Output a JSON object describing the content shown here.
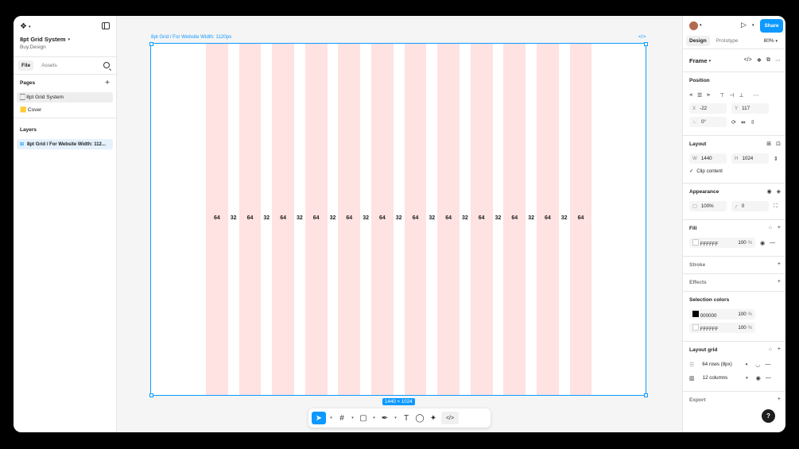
{
  "file": {
    "title": "8pt Grid System",
    "subtitle": "Buy.Design"
  },
  "left_tabs": [
    "File",
    "Assets"
  ],
  "pages": {
    "heading": "Pages",
    "items": [
      "🏻 8pt Grid System",
      "🟨 Cover"
    ]
  },
  "layers": {
    "heading": "Layers",
    "items": [
      "8pt Grid / For Website Width: 112..."
    ]
  },
  "canvas": {
    "frame_label": "8pt Grid / For Website Width: 1120px",
    "size_badge": "1440 × 1024",
    "column_labels": [
      "64",
      "32",
      "64",
      "32",
      "64",
      "32",
      "64",
      "32",
      "64",
      "32",
      "64",
      "32",
      "64",
      "32",
      "64",
      "32",
      "64",
      "32",
      "64",
      "32",
      "64",
      "32",
      "64"
    ]
  },
  "right": {
    "share": "Share",
    "tabs": [
      "Design",
      "Prototype"
    ],
    "zoom": "80%",
    "frame_title": "Frame",
    "position": {
      "heading": "Position",
      "x_label": "X",
      "x": "-22",
      "y_label": "Y",
      "y": "117",
      "rotation": "0°"
    },
    "layout": {
      "heading": "Layout",
      "w_label": "W",
      "w": "1440",
      "h_label": "H",
      "h": "1024",
      "clip": "Clip content"
    },
    "appearance": {
      "heading": "Appearance",
      "opacity": "100%",
      "radius": "0"
    },
    "fill": {
      "heading": "Fill",
      "hex": "FFFFFF",
      "opacity": "100",
      "unit": "%"
    },
    "stroke": "Stroke",
    "effects": "Effects",
    "selection_colors": {
      "heading": "Selection colors",
      "items": [
        {
          "hex": "000000",
          "opacity": "100",
          "unit": "%",
          "color": "#000000"
        },
        {
          "hex": "FFFFFF",
          "opacity": "100",
          "unit": "%",
          "color": "#FFFFFF"
        }
      ]
    },
    "layout_grid": {
      "heading": "Layout grid",
      "rows": "64 rows (8px)",
      "columns": "12 columns"
    },
    "export": "Export"
  },
  "colors": {
    "accent": "#0d99ff",
    "column": "#ffe2e2"
  }
}
